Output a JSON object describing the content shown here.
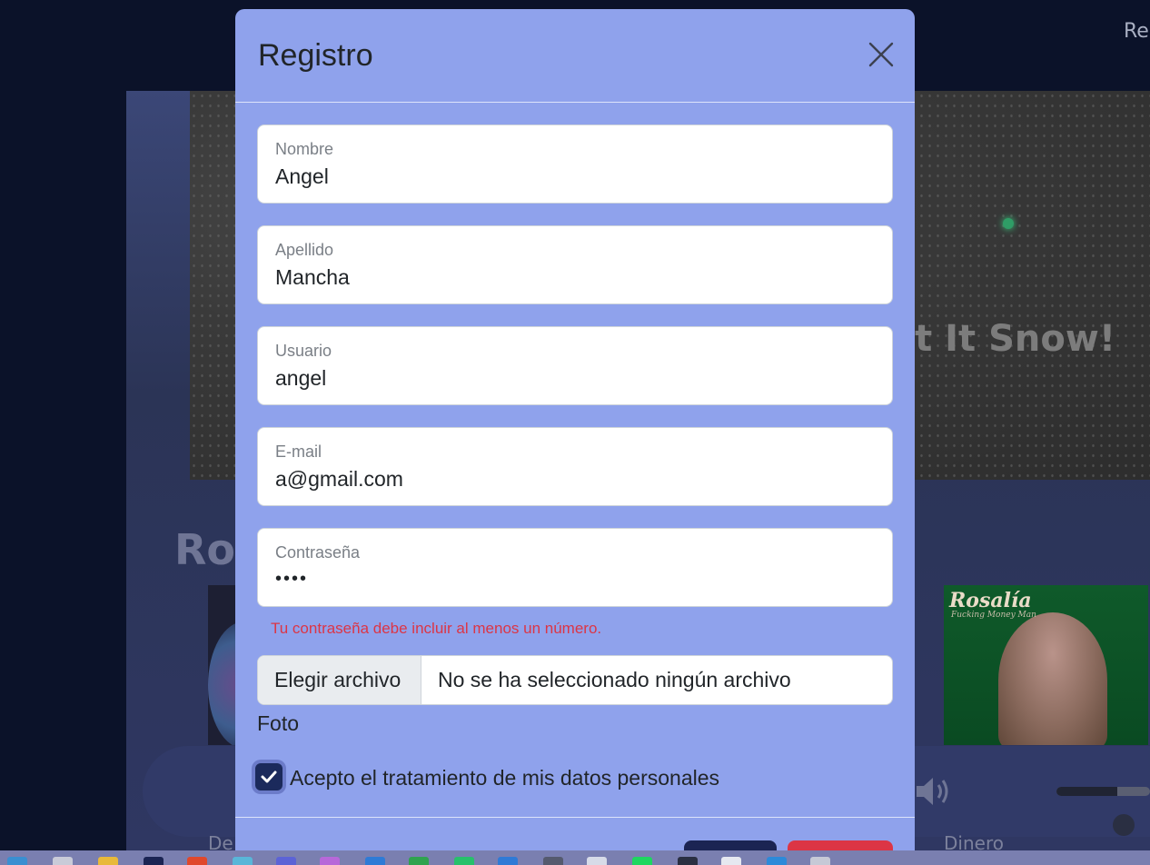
{
  "background": {
    "nav_link": "Reg",
    "hero_title": "et It Snow!",
    "section_title": "Ros",
    "album_right_title": "Rosalía",
    "album_right_subtitle": "Fucking Money Man",
    "track_left": "De",
    "track_right": "Dinero",
    "volume_level": 0.65
  },
  "modal": {
    "title": "Registro",
    "fields": {
      "nombre": {
        "label": "Nombre",
        "value": "Angel"
      },
      "apellido": {
        "label": "Apellido",
        "value": "Mancha"
      },
      "usuario": {
        "label": "Usuario",
        "value": "angel"
      },
      "email": {
        "label": "E-mail",
        "value": "a@gmail.com"
      },
      "password": {
        "label": "Contraseña",
        "value": "••••"
      }
    },
    "password_error": "Tu contraseña debe incluir al menos un número.",
    "file": {
      "button_label": "Elegir archivo",
      "status": "No se ha seleccionado ningún archivo",
      "label": "Foto"
    },
    "consent": {
      "label": "Acepto el tratamiento de mis datos personales",
      "checked": true
    }
  },
  "colors": {
    "modal_bg": "#8fa2ec",
    "page_bg": "#0b1229",
    "error": "#dc3545",
    "primary_button": "#1b2453",
    "danger_button": "#dc3545"
  }
}
